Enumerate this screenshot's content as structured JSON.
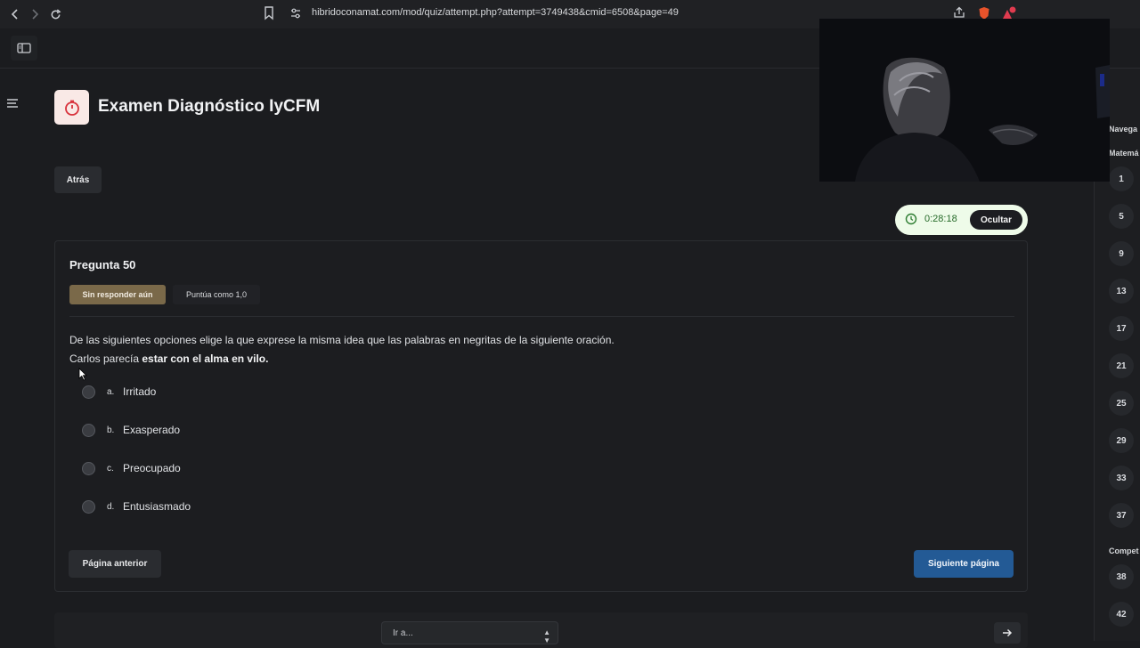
{
  "browser": {
    "url": "hibridoconamat.com/mod/quiz/attempt.php?attempt=3749438&cmid=6508&page=49"
  },
  "quiz": {
    "title": "Examen Diagnóstico IyCFM",
    "back_label": "Atrás",
    "timer": {
      "time": "0:28:18",
      "hide_label": "Ocultar"
    }
  },
  "question": {
    "number_label": "Pregunta 50",
    "state": "Sin responder aún",
    "grade": "Puntúa como 1,0",
    "prompt_line1": "De las siguientes opciones elige la que exprese la misma idea que las palabras en negritas de la siguiente oración.",
    "prompt_line2_plain": "Carlos parecía ",
    "prompt_line2_bold": "estar con el alma en vilo.",
    "options": [
      {
        "letter": "a.",
        "text": "Irritado"
      },
      {
        "letter": "b.",
        "text": "Exasperado"
      },
      {
        "letter": "c.",
        "text": "Preocupado"
      },
      {
        "letter": "d.",
        "text": "Entusiasmado"
      }
    ]
  },
  "navigation": {
    "prev_label": "Página anterior",
    "next_label": "Siguiente página",
    "jump_placeholder": "Ir a..."
  },
  "quiz_nav_panel": {
    "heading": "Navega",
    "section1": "Matemá",
    "section1_numbers": [
      "1",
      "5",
      "9",
      "13",
      "17",
      "21",
      "25",
      "29",
      "33",
      "37"
    ],
    "section2": "Compet",
    "section2_numbers": [
      "38",
      "42"
    ]
  }
}
